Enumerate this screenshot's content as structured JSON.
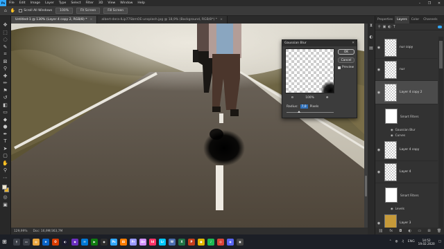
{
  "menubar": {
    "app_logo": "Ps",
    "items": [
      "File",
      "Edit",
      "Image",
      "Layer",
      "Type",
      "Select",
      "Filter",
      "3D",
      "View",
      "Window",
      "Help"
    ],
    "window_controls": [
      "–",
      "❐",
      "✕"
    ]
  },
  "options_bar": {
    "scroll_all_windows": "Scroll All Windows",
    "zoom_value": "100%",
    "fit_screen": "Fit Screen",
    "fill_screen": "Fill Screen"
  },
  "document_tabs": [
    {
      "label": "Untitled-1 @ 130% (Layer 4 copy 2, RGB/8) *",
      "active": true
    },
    {
      "label": "albert-dera-ILip77SbmOE-unsplash.jpg @ 18,9% (Background, RGB/8*) *",
      "active": false
    }
  ],
  "status_bar": {
    "zoom": "129,99%",
    "doc": "Doc: 16,9M/363,7M"
  },
  "gaussian_blur_dialog": {
    "title": "Gaussian Blur",
    "ok": "OK",
    "cancel": "Cancel",
    "preview_label": "Preview",
    "preview_checked": true,
    "zoom_percent": "100%",
    "radius_label": "Radius:",
    "radius_value": "7,0",
    "radius_unit": "Pixels",
    "radius_fraction": 0.27
  },
  "panel": {
    "tabs": [
      "Properties",
      "Layers",
      "Color",
      "Channels"
    ],
    "active_tab": "Layers",
    "layers": [
      {
        "name": "nur copy",
        "thumb": "checker"
      },
      {
        "name": "nur",
        "thumb": "checker"
      },
      {
        "name": "Layer 4 copy 2",
        "thumb": "checker",
        "selected": true
      },
      {
        "name": "Layer 4 copy",
        "thumb": "checker"
      },
      {
        "name": "Layer 4",
        "thumb": "checker"
      },
      {
        "name": "Layer 3",
        "thumb": "gold"
      }
    ],
    "smart_filters_1": {
      "label": "Smart Filters",
      "filters": [
        "Gaussian Blur",
        "Curves"
      ]
    },
    "smart_filters_2": {
      "label": "Smart Filters",
      "filters": [
        "Levels"
      ]
    }
  },
  "taskbar": {
    "time": "14:52",
    "date": "19.02.2020",
    "lang": "ENG"
  },
  "colors": {
    "accent": "#31a8ff",
    "foreground_swatch": "#f0e8d0",
    "background_swatch": "#e6b12a",
    "layer3_fill": "#c69a39"
  }
}
